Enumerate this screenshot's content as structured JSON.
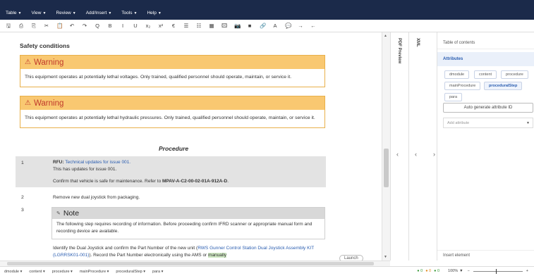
{
  "menubar": {
    "items": [
      {
        "label": "Table"
      },
      {
        "label": "View"
      },
      {
        "label": "Review"
      },
      {
        "label": "Add/Insert"
      },
      {
        "label": "Tools"
      },
      {
        "label": "Help"
      }
    ]
  },
  "toolbar": {
    "tools": [
      {
        "icon": "save-icon",
        "glyph": "🖫"
      },
      {
        "icon": "print-icon",
        "glyph": "⎙"
      },
      {
        "icon": "copy-icon",
        "glyph": "⎘"
      },
      {
        "icon": "cut-icon",
        "glyph": "✂"
      },
      {
        "icon": "paste-icon",
        "glyph": "📋"
      },
      {
        "icon": "undo-icon",
        "glyph": "↶"
      },
      {
        "icon": "redo-icon",
        "glyph": "↷"
      },
      {
        "icon": "search-icon",
        "glyph": "Q"
      },
      {
        "icon": "bold-icon",
        "glyph": "B"
      },
      {
        "icon": "italic-icon",
        "glyph": "I"
      },
      {
        "icon": "underline-icon",
        "glyph": "U"
      },
      {
        "icon": "subscript-icon",
        "glyph": "x₂"
      },
      {
        "icon": "superscript-icon",
        "glyph": "x²"
      },
      {
        "icon": "special-char-icon",
        "glyph": "€"
      },
      {
        "icon": "list-icon",
        "glyph": "☰"
      },
      {
        "icon": "numbered-list-icon",
        "glyph": "☷"
      },
      {
        "icon": "table-icon",
        "glyph": "▦"
      },
      {
        "icon": "image-icon",
        "glyph": "🖾"
      },
      {
        "icon": "camera-icon",
        "glyph": "📷"
      },
      {
        "icon": "video-icon",
        "glyph": "■"
      },
      {
        "icon": "link-icon",
        "glyph": "🔗"
      },
      {
        "icon": "text-color-icon",
        "glyph": "A"
      },
      {
        "icon": "comment-icon",
        "glyph": "💬"
      },
      {
        "icon": "forward-icon",
        "glyph": "→"
      },
      {
        "icon": "back-icon",
        "glyph": "←"
      }
    ]
  },
  "editor": {
    "section_title": "Safety conditions",
    "warnings": [
      {
        "title": "Warning",
        "body": "This equipment operates at potentially lethal voltages. Only trained, qualified personnel should operate, maintain, or service it."
      },
      {
        "title": "Warning",
        "body": "This equipment operates at potentially lethal hydraulic pressures. Only trained, qualified personnel should operate, maintain, or service it."
      }
    ],
    "procedure_title": "Procedure",
    "step1": {
      "num": "1",
      "rfu_label": "RFU:",
      "rfu_link": "Technical updates for issue 001.",
      "rfu_text": "This has updates for issue 001.",
      "confirm_prefix": "Confirm that vehicle is safe for maintenance. Refer to ",
      "confirm_ref": "MPAV-A-C2-00-02-01A-912A-D",
      "confirm_suffix": "."
    },
    "step2": {
      "num": "2",
      "text": "Remove new dual joystick from packaging."
    },
    "step3": {
      "num": "3",
      "note_title": "Note",
      "note_body": "The following step requires recording of information. Before proceeding confirm IFRD scanner or appropriate manual form and recording device are available.",
      "text_prefix": "Identify the Dual Joystick and confirm the Part Number of the new unit (",
      "text_link": "RWS Gunner Control Station Dual Joystick Assembly KIT (LGRRSK01-001)",
      "text_middle": "). Record the Part Number electronically using the AMS or ",
      "text_highlight": "manually"
    }
  },
  "side_tabs": {
    "pdf_preview": "PDF Preview",
    "xml": "XML"
  },
  "right_panel": {
    "toc": "Table of contents",
    "attributes": "Attributes",
    "breadcrumbs": [
      "dmodule",
      "content",
      "procedure",
      "mainProcedure",
      "proceduralStep",
      "para"
    ],
    "active_crumb": "proceduralStep",
    "auto_generate": "Auto generate attribute ID",
    "add_attribute_placeholder": "Add attribute",
    "insert_element": "Insert element"
  },
  "statusbar": {
    "path": [
      "dmodule",
      "content",
      "procedure",
      "mainProcedure",
      "proceduralStep",
      "para"
    ],
    "counts": [
      "0",
      "0",
      "0"
    ],
    "zoom": "100%",
    "zoom_minus": "−",
    "zoom_plus": "+"
  },
  "launch_label": "Launch",
  "colors": {
    "header": "#1b2a4a",
    "warning_bg": "#f9c871",
    "warning_text": "#c0392b",
    "link": "#2a5db0"
  }
}
